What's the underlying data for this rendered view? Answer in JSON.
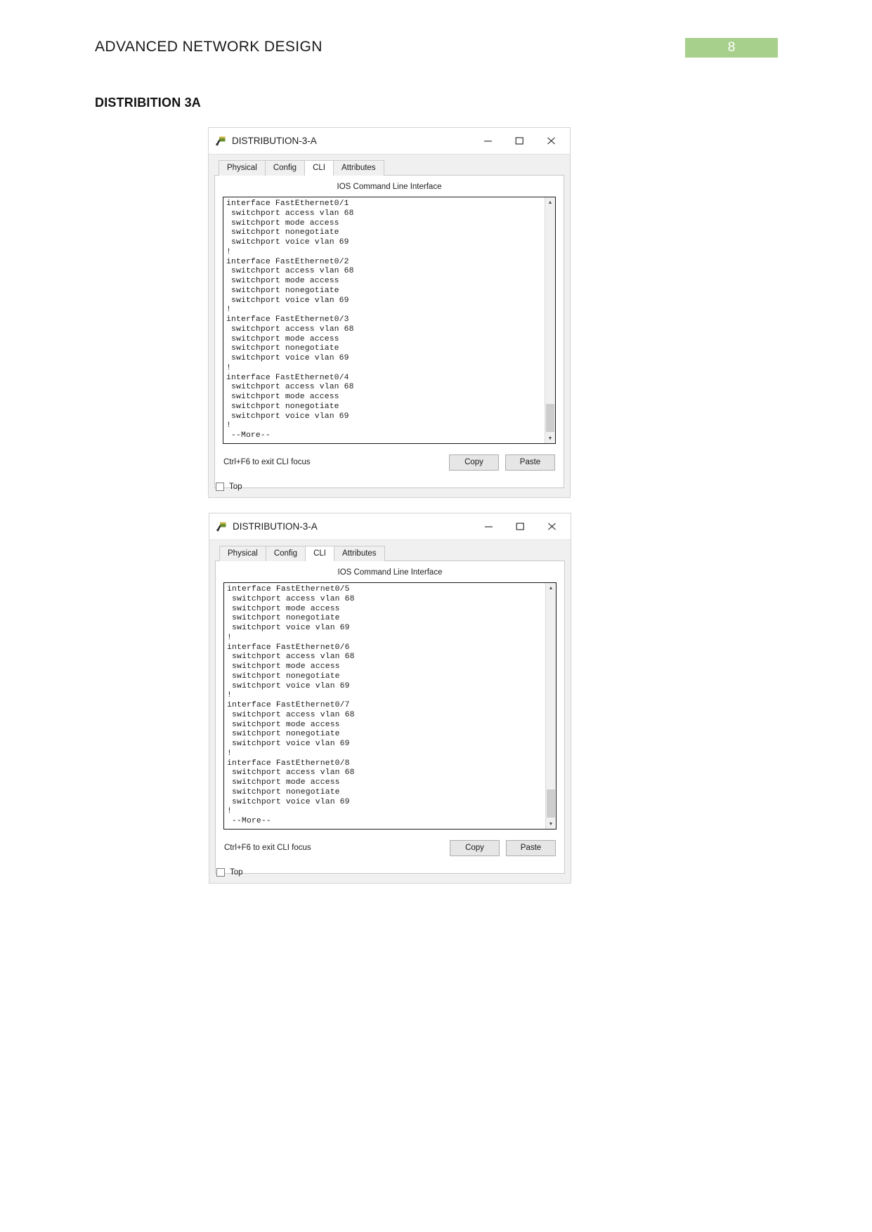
{
  "document": {
    "header_title": "ADVANCED NETWORK DESIGN",
    "page_number": "8",
    "page_badge_color": "#a8d08d",
    "section_title": "DISTRIBITION 3A"
  },
  "windows": [
    {
      "title": "DISTRIBUTION-3-A",
      "icon": "switch-device-icon",
      "controls": {
        "minimize": "minimize-icon",
        "maximize": "maximize-icon",
        "close": "close-icon"
      },
      "tabs": [
        {
          "label": "Physical",
          "active": false
        },
        {
          "label": "Config",
          "active": false
        },
        {
          "label": "CLI",
          "active": true
        },
        {
          "label": "Attributes",
          "active": false
        }
      ],
      "cli_heading": "IOS Command Line Interface",
      "terminal_text": "interface FastEthernet0/1\n switchport access vlan 68\n switchport mode access\n switchport nonegotiate\n switchport voice vlan 69\n!\ninterface FastEthernet0/2\n switchport access vlan 68\n switchport mode access\n switchport nonegotiate\n switchport voice vlan 69\n!\ninterface FastEthernet0/3\n switchport access vlan 68\n switchport mode access\n switchport nonegotiate\n switchport voice vlan 69\n!\ninterface FastEthernet0/4\n switchport access vlan 68\n switchport mode access\n switchport nonegotiate\n switchport voice vlan 69\n!\n --More--",
      "footer_hint": "Ctrl+F6 to exit CLI focus",
      "copy_label": "Copy",
      "paste_label": "Paste",
      "top_checkbox_label": "Top",
      "top_checkbox_checked": false,
      "scroll_up_glyph": "▲",
      "scroll_down_glyph": "▼"
    },
    {
      "title": "DISTRIBUTION-3-A",
      "icon": "switch-device-icon",
      "controls": {
        "minimize": "minimize-icon",
        "maximize": "maximize-icon",
        "close": "close-icon"
      },
      "tabs": [
        {
          "label": "Physical",
          "active": false
        },
        {
          "label": "Config",
          "active": false
        },
        {
          "label": "CLI",
          "active": true
        },
        {
          "label": "Attributes",
          "active": false
        }
      ],
      "cli_heading": "IOS Command Line Interface",
      "terminal_text": "interface FastEthernet0/5\n switchport access vlan 68\n switchport mode access\n switchport nonegotiate\n switchport voice vlan 69\n!\ninterface FastEthernet0/6\n switchport access vlan 68\n switchport mode access\n switchport nonegotiate\n switchport voice vlan 69\n!\ninterface FastEthernet0/7\n switchport access vlan 68\n switchport mode access\n switchport nonegotiate\n switchport voice vlan 69\n!\ninterface FastEthernet0/8\n switchport access vlan 68\n switchport mode access\n switchport nonegotiate\n switchport voice vlan 69\n!\n --More--",
      "footer_hint": "Ctrl+F6 to exit CLI focus",
      "copy_label": "Copy",
      "paste_label": "Paste",
      "top_checkbox_label": "Top",
      "top_checkbox_checked": false,
      "scroll_up_glyph": "▲",
      "scroll_down_glyph": "▼"
    }
  ]
}
